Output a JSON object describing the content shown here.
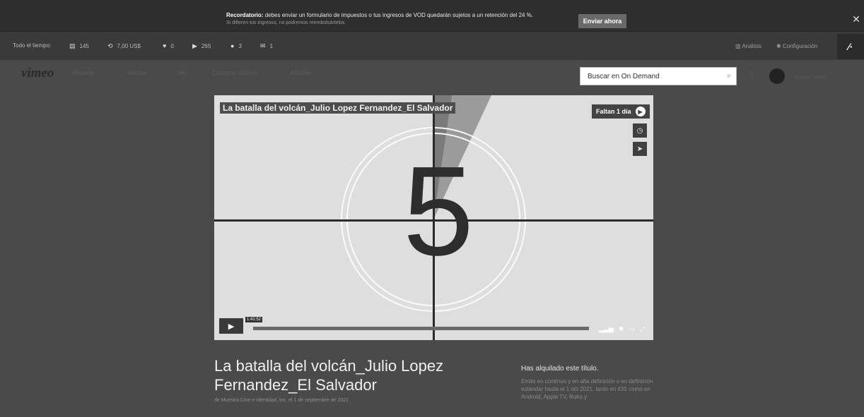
{
  "banner": {
    "title": "Recordatorio:",
    "message": "debes enviar un formulario de impuestos o tus ingresos de VOD quedarán sujetos a un retención del 24 %.",
    "sub": "Si difieren tus ingresos, no podremos reembolsártelos.",
    "button": "Enviar ahora",
    "close": "✕"
  },
  "stats": {
    "period": "Todo el tiempo:",
    "items": [
      {
        "icon": "ticket-icon",
        "glyph": "▤",
        "value": "145"
      },
      {
        "icon": "money-icon",
        "glyph": "⟲",
        "value": "7,00 US$"
      },
      {
        "icon": "heart-icon",
        "glyph": "♥",
        "value": "0"
      },
      {
        "icon": "play-icon",
        "glyph": "▶",
        "value": "265"
      },
      {
        "icon": "comment-icon",
        "glyph": "●",
        "value": "3"
      },
      {
        "icon": "mail-icon",
        "glyph": "✉",
        "value": "1"
      }
    ],
    "analytics": "Análisis",
    "settings": "Configuración",
    "toggle": "⁄·"
  },
  "nav": {
    "logo": "vimeo",
    "items": [
      "Manage",
      "Ventas",
      "Ver",
      "Comprar videos",
      "Alquilar"
    ],
    "search_placeholder": "Buscar en On Demand",
    "user": "Nuevo video"
  },
  "player": {
    "title": "La batalla del volcán_Julio Lopez Fernandez_El Salvador",
    "countdown": "5",
    "badge": "Faltan 1 día",
    "time": "1:41:52",
    "hd": "HD"
  },
  "page": {
    "title": "La batalla del volcán_Julio Lopez Fernandez_El Salvador",
    "meta": "de Muestra Cine e Identidad, Inc. el 1 de septiembre de 2021",
    "rent_heading": "Has alquilado este título.",
    "rent_body": "Emite en continuo y en alta definición o en definición estándar hasta el 1 oct 2021, tanto en iOS como en Android, Apple TV, Roku y"
  }
}
